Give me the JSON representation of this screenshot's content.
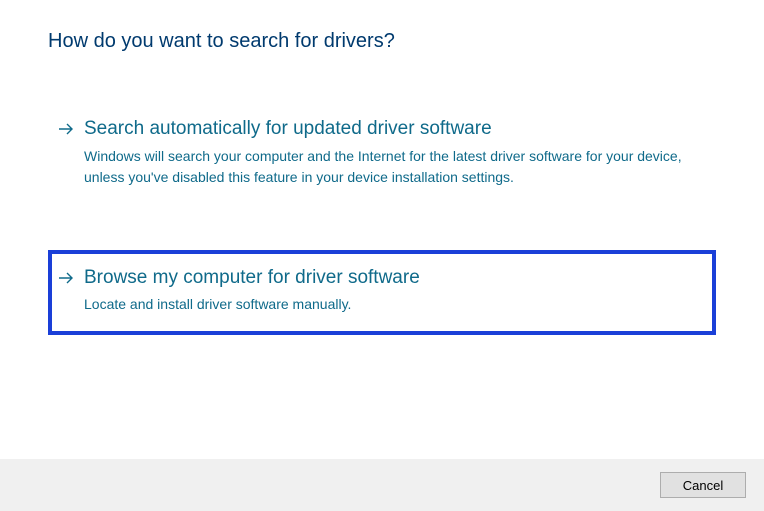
{
  "title": "How do you want to search for drivers?",
  "options": [
    {
      "title": "Search automatically for updated driver software",
      "desc": "Windows will search your computer and the Internet for the latest driver software for your device, unless you've disabled this feature in your device installation settings."
    },
    {
      "title": "Browse my computer for driver software",
      "desc": "Locate and install driver software manually."
    }
  ],
  "footer": {
    "cancel_label": "Cancel"
  }
}
